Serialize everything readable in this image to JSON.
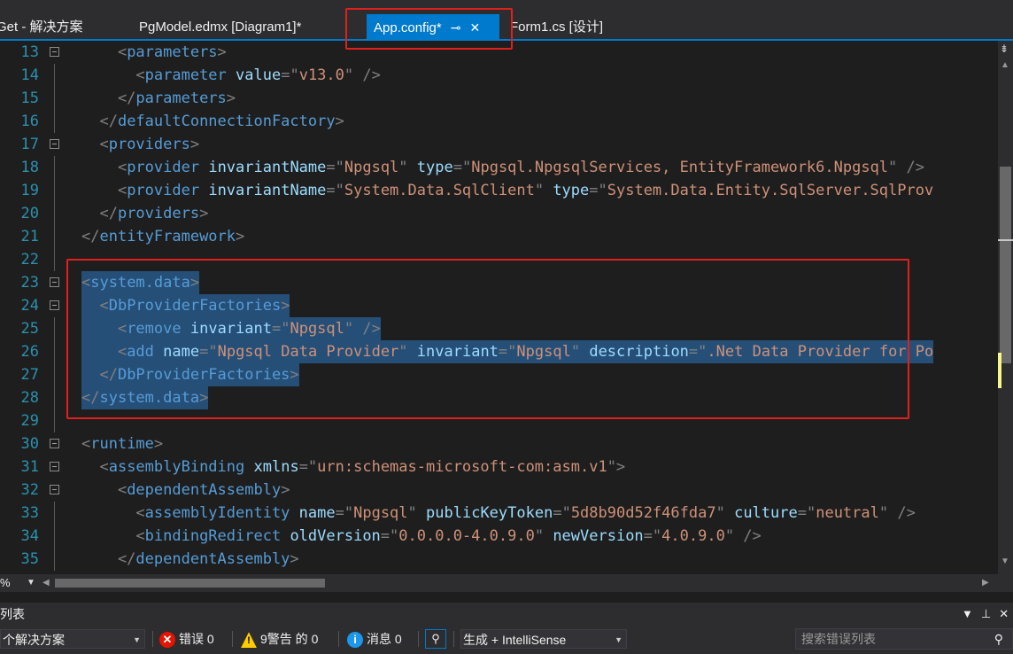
{
  "tabs": [
    {
      "label": "Get - 解决方案",
      "active": false
    },
    {
      "label": "PgModel.edmx [Diagram1]*",
      "active": false
    },
    {
      "label": "App.config*",
      "active": true,
      "pin": "⊸",
      "close": "✕"
    },
    {
      "label": "Form1.cs [设计]",
      "active": false
    }
  ],
  "editor": {
    "lines": [
      {
        "num": "13",
        "fold": true,
        "sel": false,
        "parts": [
          [
            "p",
            "    <"
          ],
          [
            "tg",
            "parameters"
          ],
          [
            "p",
            ">"
          ]
        ]
      },
      {
        "num": "14",
        "fold": false,
        "sel": false,
        "parts": [
          [
            "p",
            "      <"
          ],
          [
            "tg",
            "parameter"
          ],
          [
            "tx",
            " "
          ],
          [
            "at",
            "value"
          ],
          [
            "p",
            "=\""
          ],
          [
            "vl",
            "v13.0"
          ],
          [
            "p",
            "\" />"
          ]
        ]
      },
      {
        "num": "15",
        "fold": false,
        "sel": false,
        "parts": [
          [
            "p",
            "    </"
          ],
          [
            "tg",
            "parameters"
          ],
          [
            "p",
            ">"
          ]
        ]
      },
      {
        "num": "16",
        "fold": false,
        "sel": false,
        "parts": [
          [
            "p",
            "  </"
          ],
          [
            "tg",
            "defaultConnectionFactory"
          ],
          [
            "p",
            ">"
          ]
        ]
      },
      {
        "num": "17",
        "fold": true,
        "sel": false,
        "parts": [
          [
            "p",
            "  <"
          ],
          [
            "tg",
            "providers"
          ],
          [
            "p",
            ">"
          ]
        ]
      },
      {
        "num": "18",
        "fold": false,
        "sel": false,
        "parts": [
          [
            "p",
            "    <"
          ],
          [
            "tg",
            "provider"
          ],
          [
            "tx",
            " "
          ],
          [
            "at",
            "invariantName"
          ],
          [
            "p",
            "=\""
          ],
          [
            "vl",
            "Npgsql"
          ],
          [
            "p",
            "\""
          ],
          [
            "tx",
            " "
          ],
          [
            "at",
            "type"
          ],
          [
            "p",
            "=\""
          ],
          [
            "vl",
            "Npgsql.NpgsqlServices, EntityFramework6.Npgsql"
          ],
          [
            "p",
            "\" />"
          ]
        ]
      },
      {
        "num": "19",
        "fold": false,
        "sel": false,
        "parts": [
          [
            "p",
            "    <"
          ],
          [
            "tg",
            "provider"
          ],
          [
            "tx",
            " "
          ],
          [
            "at",
            "invariantName"
          ],
          [
            "p",
            "=\""
          ],
          [
            "vl",
            "System.Data.SqlClient"
          ],
          [
            "p",
            "\""
          ],
          [
            "tx",
            " "
          ],
          [
            "at",
            "type"
          ],
          [
            "p",
            "=\""
          ],
          [
            "vl",
            "System.Data.Entity.SqlServer.SqlProv"
          ]
        ]
      },
      {
        "num": "20",
        "fold": false,
        "sel": false,
        "parts": [
          [
            "p",
            "  </"
          ],
          [
            "tg",
            "providers"
          ],
          [
            "p",
            ">"
          ]
        ]
      },
      {
        "num": "21",
        "fold": false,
        "sel": false,
        "parts": [
          [
            "p",
            "</"
          ],
          [
            "tg",
            "entityFramework"
          ],
          [
            "p",
            ">"
          ]
        ]
      },
      {
        "num": "22",
        "fold": false,
        "sel": false,
        "parts": []
      },
      {
        "num": "23",
        "fold": true,
        "sel": true,
        "parts": [
          [
            "p",
            "<"
          ],
          [
            "tg",
            "system.data"
          ],
          [
            "p",
            ">"
          ]
        ]
      },
      {
        "num": "24",
        "fold": true,
        "sel": true,
        "parts": [
          [
            "p",
            "  <"
          ],
          [
            "tg",
            "DbProviderFactories"
          ],
          [
            "p",
            ">"
          ]
        ]
      },
      {
        "num": "25",
        "fold": false,
        "sel": true,
        "parts": [
          [
            "p",
            "    <"
          ],
          [
            "tg",
            "remove"
          ],
          [
            "tx",
            " "
          ],
          [
            "at",
            "invariant"
          ],
          [
            "p",
            "=\""
          ],
          [
            "vl",
            "Npgsql"
          ],
          [
            "p",
            "\" />"
          ]
        ]
      },
      {
        "num": "26",
        "fold": false,
        "sel": true,
        "parts": [
          [
            "p",
            "    <"
          ],
          [
            "tg",
            "add"
          ],
          [
            "tx",
            " "
          ],
          [
            "at",
            "name"
          ],
          [
            "p",
            "=\""
          ],
          [
            "vl",
            "Npgsql Data Provider"
          ],
          [
            "p",
            "\""
          ],
          [
            "tx",
            " "
          ],
          [
            "at",
            "invariant"
          ],
          [
            "p",
            "=\""
          ],
          [
            "vl",
            "Npgsql"
          ],
          [
            "p",
            "\""
          ],
          [
            "tx",
            " "
          ],
          [
            "at",
            "description"
          ],
          [
            "p",
            "=\""
          ],
          [
            "vl",
            ".Net Data Provider for Po"
          ]
        ]
      },
      {
        "num": "27",
        "fold": false,
        "sel": true,
        "parts": [
          [
            "p",
            "  </"
          ],
          [
            "tg",
            "DbProviderFactories"
          ],
          [
            "p",
            ">"
          ]
        ]
      },
      {
        "num": "28",
        "fold": false,
        "sel": true,
        "parts": [
          [
            "p",
            "</"
          ],
          [
            "tg",
            "system.data"
          ],
          [
            "p",
            ">"
          ]
        ]
      },
      {
        "num": "29",
        "fold": false,
        "sel": false,
        "parts": []
      },
      {
        "num": "30",
        "fold": true,
        "sel": false,
        "parts": [
          [
            "p",
            "<"
          ],
          [
            "tg",
            "runtime"
          ],
          [
            "p",
            ">"
          ]
        ]
      },
      {
        "num": "31",
        "fold": true,
        "sel": false,
        "parts": [
          [
            "p",
            "  <"
          ],
          [
            "tg",
            "assemblyBinding"
          ],
          [
            "tx",
            " "
          ],
          [
            "at",
            "xmlns"
          ],
          [
            "p",
            "=\""
          ],
          [
            "vl",
            "urn:schemas-microsoft-com:asm.v1"
          ],
          [
            "p",
            "\">"
          ]
        ]
      },
      {
        "num": "32",
        "fold": true,
        "sel": false,
        "parts": [
          [
            "p",
            "    <"
          ],
          [
            "tg",
            "dependentAssembly"
          ],
          [
            "p",
            ">"
          ]
        ]
      },
      {
        "num": "33",
        "fold": false,
        "sel": false,
        "parts": [
          [
            "p",
            "      <"
          ],
          [
            "tg",
            "assemblyIdentity"
          ],
          [
            "tx",
            " "
          ],
          [
            "at",
            "name"
          ],
          [
            "p",
            "=\""
          ],
          [
            "vl",
            "Npgsql"
          ],
          [
            "p",
            "\""
          ],
          [
            "tx",
            " "
          ],
          [
            "at",
            "publicKeyToken"
          ],
          [
            "p",
            "=\""
          ],
          [
            "vl",
            "5d8b90d52f46fda7"
          ],
          [
            "p",
            "\""
          ],
          [
            "tx",
            " "
          ],
          [
            "at",
            "culture"
          ],
          [
            "p",
            "=\""
          ],
          [
            "vl",
            "neutral"
          ],
          [
            "p",
            "\" />"
          ]
        ]
      },
      {
        "num": "34",
        "fold": false,
        "sel": false,
        "parts": [
          [
            "p",
            "      <"
          ],
          [
            "tg",
            "bindingRedirect"
          ],
          [
            "tx",
            " "
          ],
          [
            "at",
            "oldVersion"
          ],
          [
            "p",
            "=\""
          ],
          [
            "vl",
            "0.0.0.0-4.0.9.0"
          ],
          [
            "p",
            "\""
          ],
          [
            "tx",
            " "
          ],
          [
            "at",
            "newVersion"
          ],
          [
            "p",
            "=\""
          ],
          [
            "vl",
            "4.0.9.0"
          ],
          [
            "p",
            "\" />"
          ]
        ]
      },
      {
        "num": "35",
        "fold": false,
        "sel": false,
        "parts": [
          [
            "p",
            "    </"
          ],
          [
            "tg",
            "dependentAssembly"
          ],
          [
            "p",
            ">"
          ]
        ]
      }
    ]
  },
  "statusbar": {
    "zoom": "%"
  },
  "error_list": {
    "title": "列表",
    "scope": "个解决方案",
    "errors_label": "错误 0",
    "warnings_label": "9警告 的 0",
    "messages_label": "消息 0",
    "build_filter": "生成 + IntelliSense",
    "search_placeholder": "搜索错误列表"
  },
  "colors": {
    "accent": "#007acc",
    "highlight_box": "#e0201a",
    "selection": "#264f78"
  }
}
